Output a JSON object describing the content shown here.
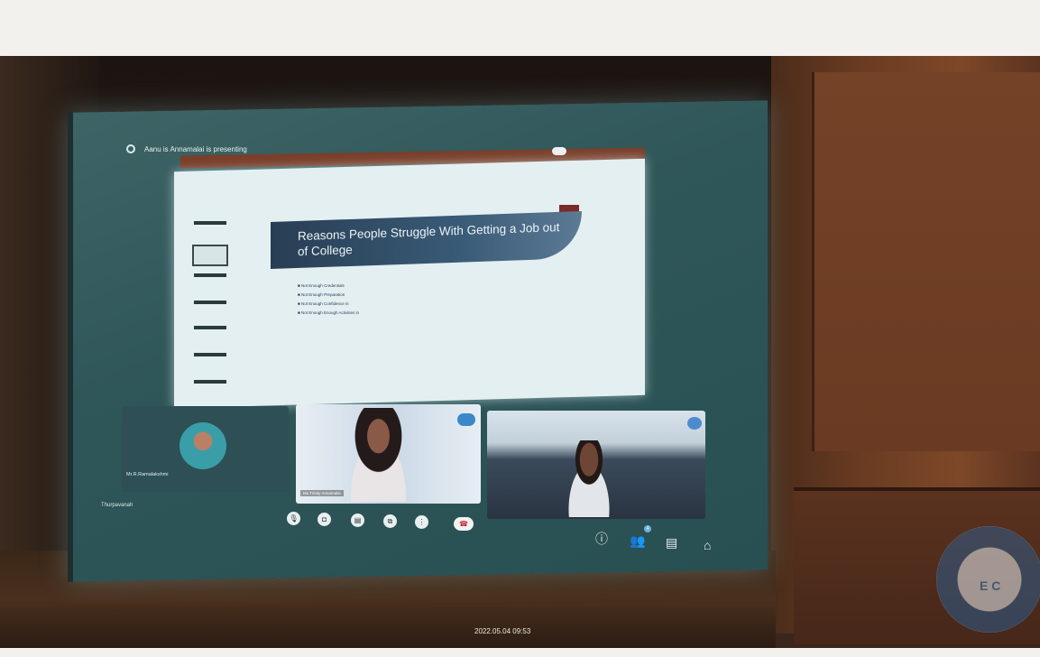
{
  "meeting": {
    "title": "Aanu is Annamalai is presenting",
    "meeting_code": "Thurpavanah"
  },
  "slide": {
    "title": "Reasons People Struggle With Getting a Job out of College",
    "bullets": [
      "Not Enough Credentials",
      "Not Enough Preparation",
      "Not Enough Confidence in",
      "Not Enough Enough Activities in"
    ]
  },
  "participants": [
    {
      "name": "Mr.R.Ramalakshmi"
    },
    {
      "name": "Ms.Trinity Annamalai"
    }
  ],
  "controls": {
    "mic": "🎙",
    "camera": "◘",
    "captions": "▤",
    "present": "⧉",
    "more": "⋮",
    "end": "☎",
    "info": "ⓘ",
    "people": "👥",
    "chat": "▤",
    "activities": "⌂",
    "people_badge": "4"
  },
  "photo": {
    "timestamp": "2022.05.04 09:53",
    "seal_text": "E C"
  }
}
